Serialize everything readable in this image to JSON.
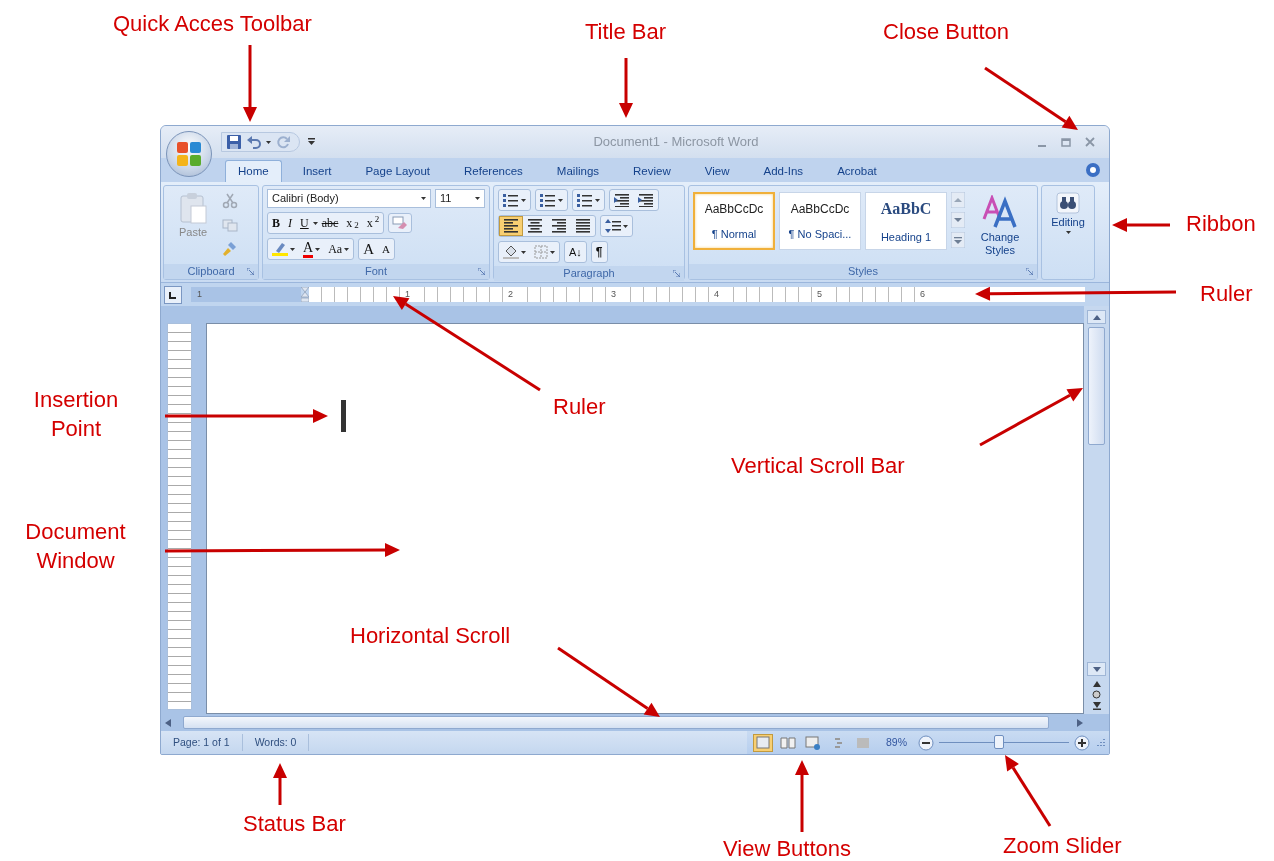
{
  "callouts": [
    {
      "text": "Quick Acces Toolbar"
    },
    {
      "text": "Title Bar"
    },
    {
      "text": "Close Button"
    },
    {
      "text": "Ribbon"
    },
    {
      "text": "Ruler"
    },
    {
      "text": "Insertion Point"
    },
    {
      "text": "Ruler"
    },
    {
      "text": "Vertical Scroll Bar"
    },
    {
      "text": "Document Window"
    },
    {
      "text": "Horizontal Scroll"
    },
    {
      "text": "Status Bar"
    },
    {
      "text": "View Buttons"
    },
    {
      "text": "Zoom Slider"
    }
  ],
  "window": {
    "title": "Document1 - Microsoft Word"
  },
  "tabs": [
    {
      "label": "Home",
      "selected": true
    },
    {
      "label": "Insert",
      "selected": false
    },
    {
      "label": "Page Layout",
      "selected": false
    },
    {
      "label": "References",
      "selected": false
    },
    {
      "label": "Mailings",
      "selected": false
    },
    {
      "label": "Review",
      "selected": false
    },
    {
      "label": "View",
      "selected": false
    },
    {
      "label": "Add-Ins",
      "selected": false
    },
    {
      "label": "Acrobat",
      "selected": false
    }
  ],
  "ribbon": {
    "clipboard": {
      "label": "Clipboard",
      "paste": "Paste"
    },
    "font": {
      "label": "Font",
      "font_name": "Calibri (Body)",
      "font_size": "11",
      "format_buttons": [
        "B",
        "I",
        "U",
        "abc",
        "x$_{2}$",
        "x$^{2}$"
      ],
      "color_button": "A",
      "case_button": "Aa",
      "grow_button": "A",
      "shrink_button": "A"
    },
    "paragraph": {
      "label": "Paragraph",
      "alignment": [
        {
          "kind": "left",
          "selected": true
        },
        {
          "kind": "center",
          "selected": false
        },
        {
          "kind": "right",
          "selected": false
        },
        {
          "kind": "justify",
          "selected": false
        }
      ],
      "sort_button": "A↓",
      "marks_button": "¶"
    },
    "styles": {
      "label": "Styles",
      "gallery": [
        {
          "preview": "AaBbCcDc",
          "name": "¶ Normal",
          "selected": true
        },
        {
          "preview": "AaBbCcDc",
          "name": "¶ No Spaci...",
          "selected": false
        },
        {
          "preview": "AaBbC",
          "name": "Heading 1",
          "selected": false
        }
      ],
      "change_styles": "Change Styles"
    },
    "editing": {
      "label": "Editing"
    }
  },
  "ruler": {
    "labels": [
      "1",
      "1",
      "2",
      "3",
      "4",
      "5",
      "6"
    ]
  },
  "status_bar": {
    "page": "Page: 1 of 1",
    "words": "Words: 0",
    "view_buttons": [
      {
        "selected": true
      },
      {
        "selected": false
      },
      {
        "selected": false
      },
      {
        "selected": false
      },
      {
        "selected": false
      }
    ],
    "zoom": "89%",
    "zoom_slider": {
      "level": 0.46
    }
  }
}
